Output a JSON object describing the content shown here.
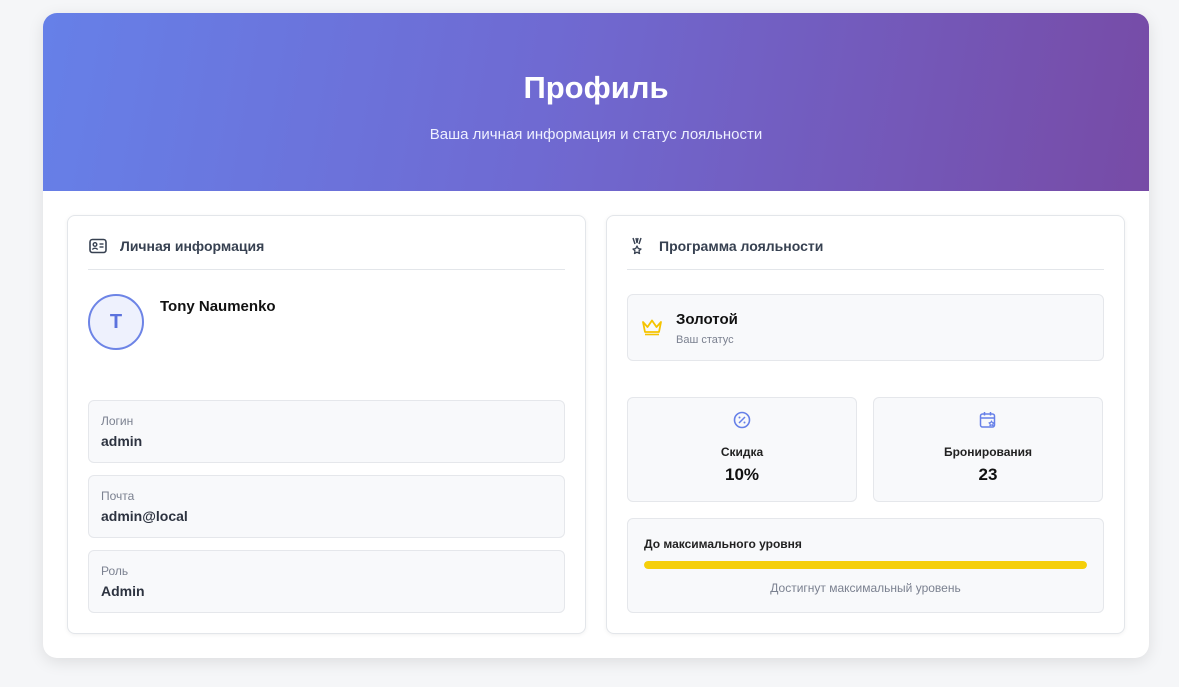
{
  "header": {
    "title": "Профиль",
    "subtitle": "Ваша личная информация и статус лояльности"
  },
  "personal": {
    "section_title": "Личная информация",
    "section_icon": "id-card-icon",
    "avatar_initial": "T",
    "user_name": "Tony Naumenko",
    "fields": [
      {
        "label": "Логин",
        "value": "admin"
      },
      {
        "label": "Почта",
        "value": "admin@local"
      },
      {
        "label": "Роль",
        "value": "Admin"
      }
    ]
  },
  "loyalty": {
    "section_title": "Программа лояльности",
    "section_icon": "medal-icon",
    "status_name": "Золотой",
    "status_caption": "Ваш статус",
    "status_icon": "crown-icon",
    "stats": [
      {
        "label": "Скидка",
        "value": "10%",
        "icon": "percent-icon"
      },
      {
        "label": "Бронирования",
        "value": "23",
        "icon": "calendar-star-icon"
      }
    ],
    "progress_label": "До максимального уровня",
    "progress_fraction": 1.0,
    "progress_note": "Достигнут максимальный уровень"
  },
  "colors": {
    "accent": "#6680e8",
    "gold": "#f5cf0a",
    "gradient_start": "#6680e8",
    "gradient_end": "#774ba6"
  }
}
